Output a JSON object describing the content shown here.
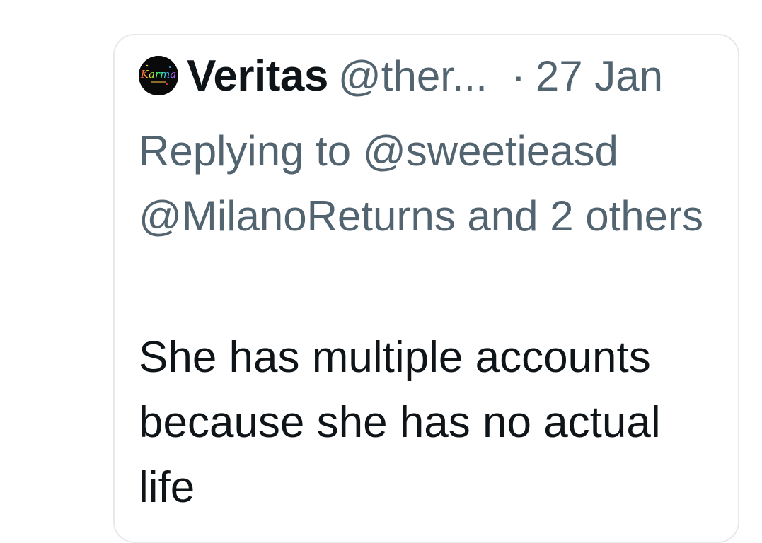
{
  "tweet": {
    "display_name": "Veritas",
    "handle": "@ther...",
    "separator": "·",
    "date": "27 Jan",
    "avatar_text": "Karma",
    "reply_line": "Replying to @sweetieasd @MilanoReturns and 2 others",
    "text": "She has multiple accounts because she has no actual life"
  },
  "colors": {
    "primary_text": "#0f1419",
    "secondary_text": "#536471",
    "border": "#e6e9ec"
  }
}
